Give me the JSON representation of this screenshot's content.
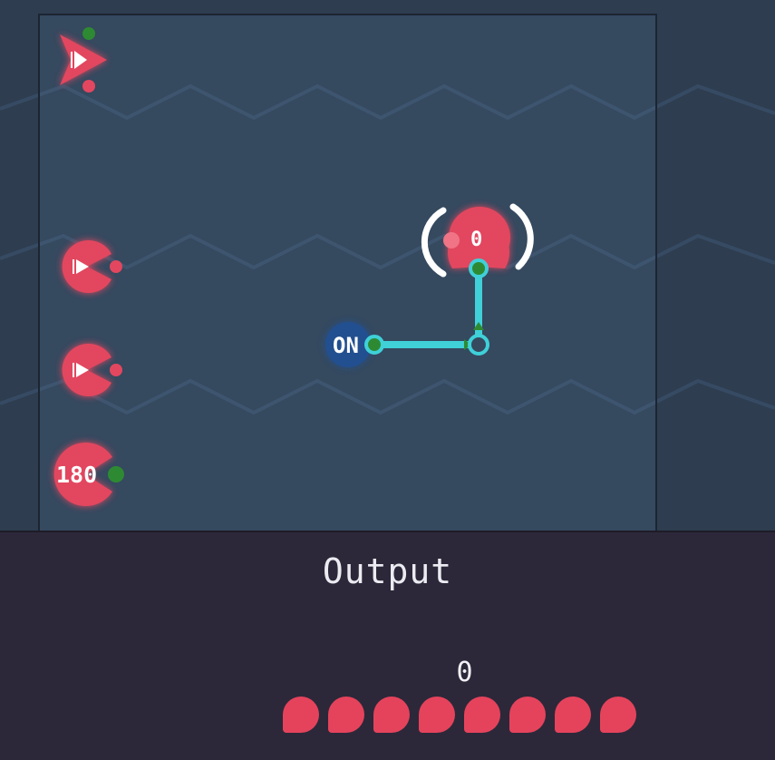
{
  "board": {
    "number_node": {
      "label": "180"
    },
    "switch_node": {
      "label": "ON"
    },
    "display_node": {
      "label": "0"
    }
  },
  "output": {
    "title": "Output",
    "value": "0",
    "bits": [
      0,
      0,
      0,
      0,
      0,
      0,
      0,
      0
    ]
  },
  "colors": {
    "node_red": "#e2475f",
    "wire_cyan": "#3fd0d8",
    "port_green": "#2e8a32",
    "switch_blue": "#214f8f"
  }
}
